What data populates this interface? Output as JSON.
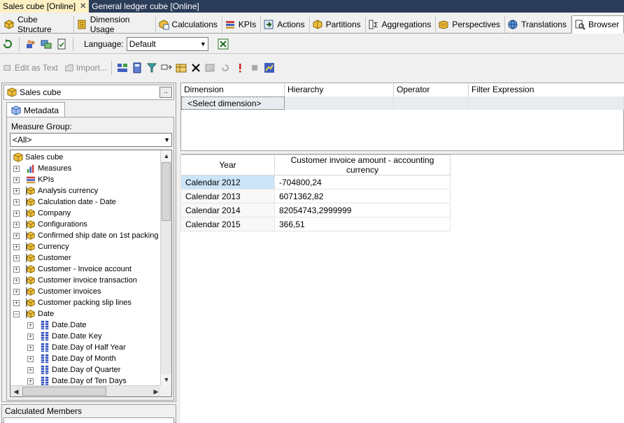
{
  "doc_tabs": [
    {
      "label": "Sales cube [Online]",
      "active": true
    },
    {
      "label": "General ledger cube [Online]",
      "active": false
    }
  ],
  "designer_tabs": [
    {
      "label": "Cube Structure",
      "icon": "cube-structure-icon",
      "active": false
    },
    {
      "label": "Dimension Usage",
      "icon": "dimension-usage-icon",
      "active": false
    },
    {
      "label": "Calculations",
      "icon": "calculations-icon",
      "active": false
    },
    {
      "label": "KPIs",
      "icon": "kpis-icon",
      "active": false
    },
    {
      "label": "Actions",
      "icon": "actions-icon",
      "active": false
    },
    {
      "label": "Partitions",
      "icon": "partitions-icon",
      "active": false
    },
    {
      "label": "Aggregations",
      "icon": "aggregations-icon",
      "active": false
    },
    {
      "label": "Perspectives",
      "icon": "perspectives-icon",
      "active": false
    },
    {
      "label": "Translations",
      "icon": "translations-icon",
      "active": false
    },
    {
      "label": "Browser",
      "icon": "browser-icon",
      "active": true
    }
  ],
  "lang_bar": {
    "label": "Language:",
    "value": "Default"
  },
  "browse_bar": {
    "edit_as_text": "Edit as Text",
    "import": "Import..."
  },
  "left_panel": {
    "cube_name": "Sales cube",
    "dots": "..",
    "metadata_tab": "Metadata",
    "measure_group_label": "Measure Group:",
    "measure_group_value": "<All>",
    "tree": [
      {
        "label": "Sales cube",
        "icon": "cube",
        "level": 0,
        "expander": ""
      },
      {
        "label": "Measures",
        "icon": "measures",
        "level": 1,
        "expander": "+"
      },
      {
        "label": "KPIs",
        "icon": "kpi",
        "level": 1,
        "expander": "+"
      },
      {
        "label": "Analysis currency",
        "icon": "dimension",
        "level": 1,
        "expander": "+"
      },
      {
        "label": "Calculation date - Date",
        "icon": "dimension",
        "level": 1,
        "expander": "+"
      },
      {
        "label": "Company",
        "icon": "dimension",
        "level": 1,
        "expander": "+"
      },
      {
        "label": "Configurations",
        "icon": "dimension",
        "level": 1,
        "expander": "+"
      },
      {
        "label": "Confirmed ship date on 1st packing",
        "icon": "dimension",
        "level": 1,
        "expander": "+"
      },
      {
        "label": "Currency",
        "icon": "dimension",
        "level": 1,
        "expander": "+"
      },
      {
        "label": "Customer",
        "icon": "dimension",
        "level": 1,
        "expander": "+"
      },
      {
        "label": "Customer - Invoice account",
        "icon": "dimension",
        "level": 1,
        "expander": "+"
      },
      {
        "label": "Customer invoice transaction",
        "icon": "dimension",
        "level": 1,
        "expander": "+"
      },
      {
        "label": "Customer invoices",
        "icon": "dimension",
        "level": 1,
        "expander": "+"
      },
      {
        "label": "Customer packing slip lines",
        "icon": "dimension",
        "level": 1,
        "expander": "+"
      },
      {
        "label": "Date",
        "icon": "dimension",
        "level": 1,
        "expander": "−"
      },
      {
        "label": "Date.Date",
        "icon": "hierarchy",
        "level": 2,
        "expander": "+"
      },
      {
        "label": "Date.Date Key",
        "icon": "hierarchy",
        "level": 2,
        "expander": "+"
      },
      {
        "label": "Date.Day of Half Year",
        "icon": "hierarchy",
        "level": 2,
        "expander": "+"
      },
      {
        "label": "Date.Day of Month",
        "icon": "hierarchy",
        "level": 2,
        "expander": "+"
      },
      {
        "label": "Date.Day of Quarter",
        "icon": "hierarchy",
        "level": 2,
        "expander": "+"
      },
      {
        "label": "Date.Day of Ten Days",
        "icon": "hierarchy",
        "level": 2,
        "expander": "+"
      }
    ],
    "calculated_members": "Calculated Members"
  },
  "filter_grid": {
    "headers": [
      "Dimension",
      "Hierarchy",
      "Operator",
      "Filter Expression"
    ],
    "placeholder": "<Select dimension>"
  },
  "results": {
    "headers": [
      "Year",
      "Customer invoice amount - accounting currency"
    ],
    "rows": [
      {
        "label": "Calendar 2012",
        "value": "-704800,24",
        "selected": true
      },
      {
        "label": "Calendar 2013",
        "value": "6071362,82",
        "selected": false
      },
      {
        "label": "Calendar 2014",
        "value": "82054743,2999999",
        "selected": false
      },
      {
        "label": "Calendar 2015",
        "value": "366,51",
        "selected": false
      }
    ]
  }
}
